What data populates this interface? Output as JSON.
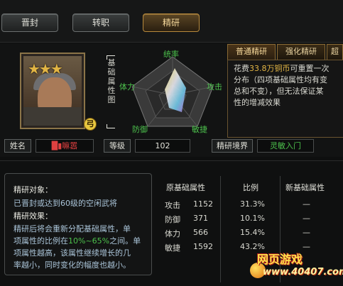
{
  "top_tabs": [
    "晋封",
    "转职",
    "精研"
  ],
  "active_tab": "精研",
  "radar": {
    "title_vertical": "基础属性图",
    "labels": {
      "top": "统率",
      "left": "体力",
      "right": "攻击",
      "bottom_left": "防御",
      "bottom_right": "敏捷"
    }
  },
  "right_panel": {
    "tabs": [
      "普通精研",
      "强化精研",
      "超"
    ],
    "cost_prefix": "花费",
    "cost_amount": "33.8万铜币",
    "cost_suffix": "可重置一次",
    "line2": "分布（四项基础属性均有变",
    "line3": "总和不变），但无法保证某",
    "line4": "性的增减效果"
  },
  "info": {
    "name_label": "姓名",
    "name_value": "█▮嘛嚣",
    "level_label": "等级",
    "level_value": "102",
    "realm_label": "精研境界",
    "realm_value": "灵敏入门"
  },
  "description": {
    "target_heading": "精研对象：",
    "target_text": "已晋封或达到60级的空闲武将",
    "effect_heading": "精研效果：",
    "effect_lines": [
      "精研后将会重新分配基础属性，单",
      "项属性的比例在10%~65%之间。单",
      "项属性越高，该属性继续增长的几",
      "率越小，同时变化的幅度也越小。"
    ],
    "range_highlight": "10%~65%"
  },
  "attr_table": {
    "headers": [
      "原基础属性",
      "比例",
      "新基础属性"
    ],
    "rows": [
      {
        "name": "攻击",
        "value": "1152",
        "ratio": "31.3%",
        "new": "—"
      },
      {
        "name": "防御",
        "value": "371",
        "ratio": "10.1%",
        "new": "—"
      },
      {
        "name": "体力",
        "value": "566",
        "ratio": "15.4%",
        "new": "—"
      },
      {
        "name": "敏捷",
        "value": "1592",
        "ratio": "43.2%",
        "new": "—"
      }
    ]
  },
  "watermark": {
    "line1": "网页游戏",
    "line2": "www.40407.com"
  },
  "colors": {
    "accent_gold": "#e2b544",
    "green": "#4cc04c",
    "name_red": "#e04040"
  }
}
